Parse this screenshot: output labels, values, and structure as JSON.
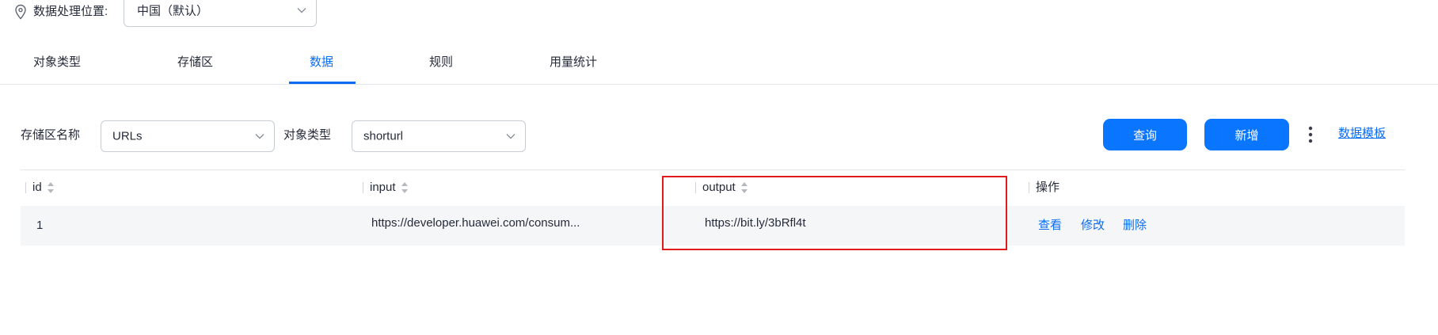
{
  "location": {
    "label": "数据处理位置:",
    "selected": "中国（默认）"
  },
  "tabs": [
    {
      "label": "对象类型",
      "active": false
    },
    {
      "label": "存储区",
      "active": false
    },
    {
      "label": "数据",
      "active": true
    },
    {
      "label": "规则",
      "active": false
    },
    {
      "label": "用量统计",
      "active": false
    }
  ],
  "filters": {
    "zone_label": "存储区名称",
    "zone_value": "URLs",
    "type_label": "对象类型",
    "type_value": "shorturl"
  },
  "actions": {
    "query_label": "查询",
    "add_label": "新增",
    "template_label": "数据模板"
  },
  "table": {
    "columns": [
      "id",
      "input",
      "output",
      "操作"
    ],
    "rows": [
      {
        "id": "1",
        "input": "https://developer.huawei.com/consum...",
        "output": "https://bit.ly/3bRfl4t",
        "ops": [
          "查看",
          "修改",
          "删除"
        ]
      }
    ]
  },
  "colors": {
    "accent": "#0a6cf5",
    "button": "#0a75ff",
    "highlight": "#e11b1b"
  },
  "icons": {
    "location": "map-pin-icon",
    "chevron": "chevron-down-icon",
    "more": "vertical-ellipsis-icon",
    "sort": "sort-icon"
  }
}
